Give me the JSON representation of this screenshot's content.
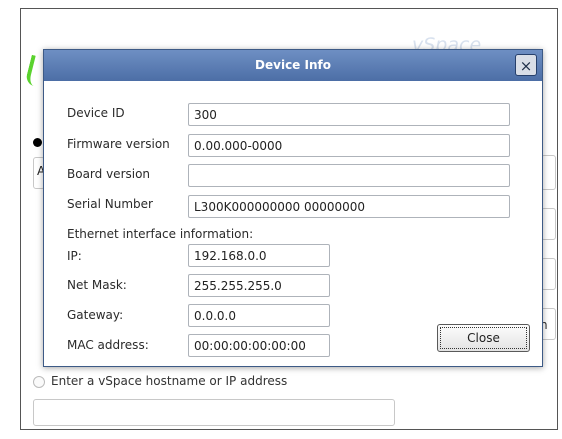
{
  "background": {
    "watermark": "vSpace",
    "host_option_label": "Enter a vSpace hostname or IP address",
    "partial_field_char": "A",
    "partial_button_char": "n"
  },
  "dialog": {
    "title": "Device Info",
    "close_icon": "×",
    "close_button_label": "Close",
    "fields": {
      "device_id": {
        "label": "Device ID",
        "value": "300"
      },
      "firmware": {
        "label": "Firmware version",
        "value": "0.00.000-0000"
      },
      "board": {
        "label": "Board version",
        "value": ""
      },
      "serial": {
        "label": "Serial Number",
        "value": "L300K000000000 00000000"
      }
    },
    "ethernet_heading": "Ethernet interface information:",
    "ethernet": {
      "ip": {
        "label": "IP:",
        "value": "192.168.0.0"
      },
      "netmask": {
        "label": "Net Mask:",
        "value": "255.255.255.0"
      },
      "gateway": {
        "label": "Gateway:",
        "value": "0.0.0.0"
      },
      "mac": {
        "label": "MAC address:",
        "value": "00:00:00:00:00:00"
      }
    }
  },
  "colors": {
    "titlebar": "#5b7db5",
    "accent_green": "#5ad22e"
  }
}
